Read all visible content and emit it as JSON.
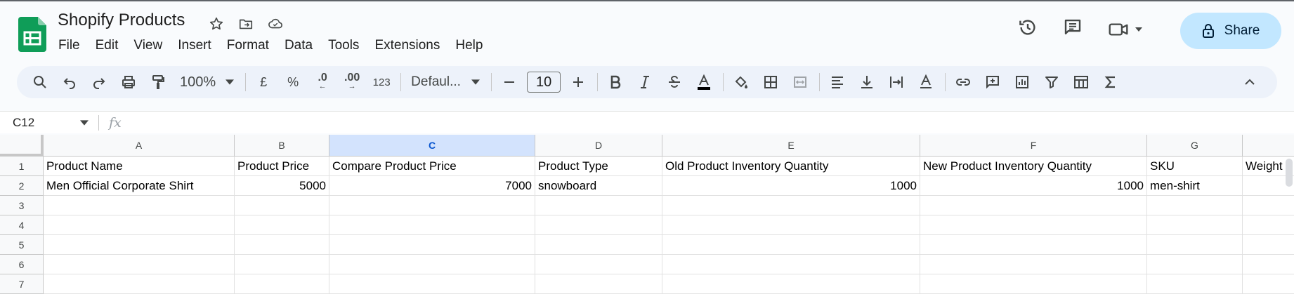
{
  "doc": {
    "title": "Shopify Products"
  },
  "menu": [
    "File",
    "Edit",
    "View",
    "Insert",
    "Format",
    "Data",
    "Tools",
    "Extensions",
    "Help"
  ],
  "share": {
    "label": "Share"
  },
  "toolbar": {
    "zoom": "100%",
    "currency": "£",
    "percent": "%",
    "dec_decrease": ".0",
    "dec_increase": ".00",
    "number_format": "123",
    "font": "Defaul...",
    "font_size": "10"
  },
  "formula_bar": {
    "name_box": "C12",
    "fx": "fx",
    "content": ""
  },
  "sheet": {
    "selected_column": "C",
    "columns": [
      "A",
      "B",
      "C",
      "D",
      "E",
      "F",
      "G",
      ""
    ],
    "row_numbers": [
      "1",
      "2",
      "3",
      "4",
      "5",
      "6",
      "7"
    ],
    "rows": [
      [
        "Product Name",
        "Product Price",
        "Compare Product Price",
        "Product Type",
        "Old Product Inventory Quantity",
        "New Product Inventory Quantity",
        "SKU",
        "Weight"
      ],
      [
        "Men Official Corporate Shirt",
        "5000",
        "7000",
        "snowboard",
        "1000",
        "1000",
        "men-shirt",
        ""
      ],
      [
        "",
        "",
        "",
        "",
        "",
        "",
        "",
        ""
      ],
      [
        "",
        "",
        "",
        "",
        "",
        "",
        "",
        ""
      ],
      [
        "",
        "",
        "",
        "",
        "",
        "",
        "",
        ""
      ],
      [
        "",
        "",
        "",
        "",
        "",
        "",
        "",
        ""
      ],
      [
        "",
        "",
        "",
        "",
        "",
        "",
        "",
        ""
      ]
    ]
  },
  "colors": {
    "accent": "#0b57d0",
    "share_bg": "#c2e7ff",
    "toolbar_bg": "#edf2fa",
    "logo_green": "#0f9d58"
  }
}
